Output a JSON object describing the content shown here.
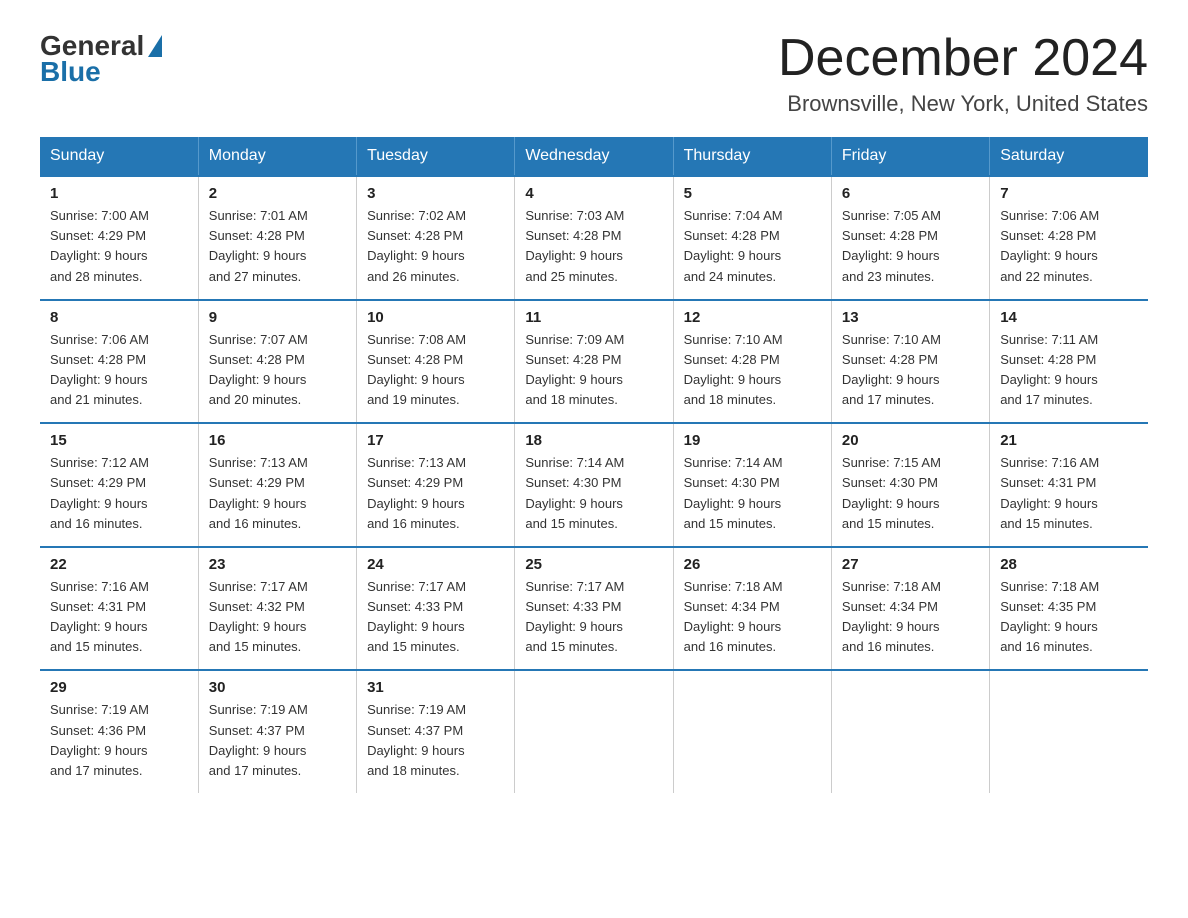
{
  "header": {
    "logo_general": "General",
    "logo_blue": "Blue",
    "month_title": "December 2024",
    "location": "Brownsville, New York, United States"
  },
  "weekdays": [
    "Sunday",
    "Monday",
    "Tuesday",
    "Wednesday",
    "Thursday",
    "Friday",
    "Saturday"
  ],
  "weeks": [
    [
      {
        "day": "1",
        "sunrise": "7:00 AM",
        "sunset": "4:29 PM",
        "daylight": "9 hours and 28 minutes."
      },
      {
        "day": "2",
        "sunrise": "7:01 AM",
        "sunset": "4:28 PM",
        "daylight": "9 hours and 27 minutes."
      },
      {
        "day": "3",
        "sunrise": "7:02 AM",
        "sunset": "4:28 PM",
        "daylight": "9 hours and 26 minutes."
      },
      {
        "day": "4",
        "sunrise": "7:03 AM",
        "sunset": "4:28 PM",
        "daylight": "9 hours and 25 minutes."
      },
      {
        "day": "5",
        "sunrise": "7:04 AM",
        "sunset": "4:28 PM",
        "daylight": "9 hours and 24 minutes."
      },
      {
        "day": "6",
        "sunrise": "7:05 AM",
        "sunset": "4:28 PM",
        "daylight": "9 hours and 23 minutes."
      },
      {
        "day": "7",
        "sunrise": "7:06 AM",
        "sunset": "4:28 PM",
        "daylight": "9 hours and 22 minutes."
      }
    ],
    [
      {
        "day": "8",
        "sunrise": "7:06 AM",
        "sunset": "4:28 PM",
        "daylight": "9 hours and 21 minutes."
      },
      {
        "day": "9",
        "sunrise": "7:07 AM",
        "sunset": "4:28 PM",
        "daylight": "9 hours and 20 minutes."
      },
      {
        "day": "10",
        "sunrise": "7:08 AM",
        "sunset": "4:28 PM",
        "daylight": "9 hours and 19 minutes."
      },
      {
        "day": "11",
        "sunrise": "7:09 AM",
        "sunset": "4:28 PM",
        "daylight": "9 hours and 18 minutes."
      },
      {
        "day": "12",
        "sunrise": "7:10 AM",
        "sunset": "4:28 PM",
        "daylight": "9 hours and 18 minutes."
      },
      {
        "day": "13",
        "sunrise": "7:10 AM",
        "sunset": "4:28 PM",
        "daylight": "9 hours and 17 minutes."
      },
      {
        "day": "14",
        "sunrise": "7:11 AM",
        "sunset": "4:28 PM",
        "daylight": "9 hours and 17 minutes."
      }
    ],
    [
      {
        "day": "15",
        "sunrise": "7:12 AM",
        "sunset": "4:29 PM",
        "daylight": "9 hours and 16 minutes."
      },
      {
        "day": "16",
        "sunrise": "7:13 AM",
        "sunset": "4:29 PM",
        "daylight": "9 hours and 16 minutes."
      },
      {
        "day": "17",
        "sunrise": "7:13 AM",
        "sunset": "4:29 PM",
        "daylight": "9 hours and 16 minutes."
      },
      {
        "day": "18",
        "sunrise": "7:14 AM",
        "sunset": "4:30 PM",
        "daylight": "9 hours and 15 minutes."
      },
      {
        "day": "19",
        "sunrise": "7:14 AM",
        "sunset": "4:30 PM",
        "daylight": "9 hours and 15 minutes."
      },
      {
        "day": "20",
        "sunrise": "7:15 AM",
        "sunset": "4:30 PM",
        "daylight": "9 hours and 15 minutes."
      },
      {
        "day": "21",
        "sunrise": "7:16 AM",
        "sunset": "4:31 PM",
        "daylight": "9 hours and 15 minutes."
      }
    ],
    [
      {
        "day": "22",
        "sunrise": "7:16 AM",
        "sunset": "4:31 PM",
        "daylight": "9 hours and 15 minutes."
      },
      {
        "day": "23",
        "sunrise": "7:17 AM",
        "sunset": "4:32 PM",
        "daylight": "9 hours and 15 minutes."
      },
      {
        "day": "24",
        "sunrise": "7:17 AM",
        "sunset": "4:33 PM",
        "daylight": "9 hours and 15 minutes."
      },
      {
        "day": "25",
        "sunrise": "7:17 AM",
        "sunset": "4:33 PM",
        "daylight": "9 hours and 15 minutes."
      },
      {
        "day": "26",
        "sunrise": "7:18 AM",
        "sunset": "4:34 PM",
        "daylight": "9 hours and 16 minutes."
      },
      {
        "day": "27",
        "sunrise": "7:18 AM",
        "sunset": "4:34 PM",
        "daylight": "9 hours and 16 minutes."
      },
      {
        "day": "28",
        "sunrise": "7:18 AM",
        "sunset": "4:35 PM",
        "daylight": "9 hours and 16 minutes."
      }
    ],
    [
      {
        "day": "29",
        "sunrise": "7:19 AM",
        "sunset": "4:36 PM",
        "daylight": "9 hours and 17 minutes."
      },
      {
        "day": "30",
        "sunrise": "7:19 AM",
        "sunset": "4:37 PM",
        "daylight": "9 hours and 17 minutes."
      },
      {
        "day": "31",
        "sunrise": "7:19 AM",
        "sunset": "4:37 PM",
        "daylight": "9 hours and 18 minutes."
      },
      null,
      null,
      null,
      null
    ]
  ],
  "labels": {
    "sunrise": "Sunrise:",
    "sunset": "Sunset:",
    "daylight": "Daylight:"
  }
}
